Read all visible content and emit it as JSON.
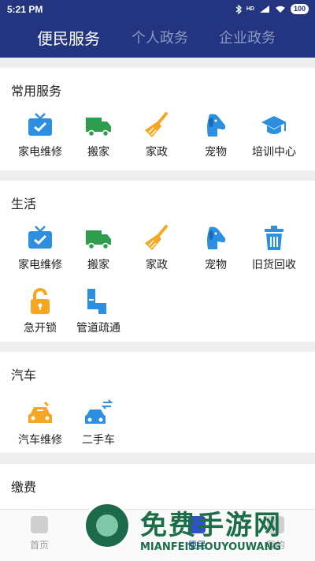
{
  "status": {
    "time": "5:21 PM",
    "network": "HD",
    "battery": "100"
  },
  "tabs": [
    {
      "label": "便民服务",
      "active": true
    },
    {
      "label": "个人政务",
      "active": false
    },
    {
      "label": "企业政务",
      "active": false
    }
  ],
  "sections": [
    {
      "title": "常用服务",
      "items": [
        {
          "label": "家电维修",
          "icon": "tv-icon"
        },
        {
          "label": "搬家",
          "icon": "truck-icon"
        },
        {
          "label": "家政",
          "icon": "broom-icon"
        },
        {
          "label": "宠物",
          "icon": "dog-icon"
        },
        {
          "label": "培训中心",
          "icon": "graduation-cap-icon"
        }
      ]
    },
    {
      "title": "生活",
      "items": [
        {
          "label": "家电维修",
          "icon": "tv-icon"
        },
        {
          "label": "搬家",
          "icon": "truck-icon"
        },
        {
          "label": "家政",
          "icon": "broom-icon"
        },
        {
          "label": "宠物",
          "icon": "dog-icon"
        },
        {
          "label": "旧货回收",
          "icon": "trash-icon"
        },
        {
          "label": "急开锁",
          "icon": "unlock-icon"
        },
        {
          "label": "管道疏通",
          "icon": "pipe-icon"
        }
      ]
    },
    {
      "title": "汽车",
      "items": [
        {
          "label": "汽车维修",
          "icon": "car-repair-icon"
        },
        {
          "label": "二手车",
          "icon": "car-exchange-icon"
        }
      ]
    },
    {
      "title": "缴费",
      "items": []
    }
  ],
  "bottom_nav": [
    {
      "label": "首页",
      "icon": "home-icon",
      "active": false
    },
    {
      "label": "",
      "icon": "service-icon",
      "active": false
    },
    {
      "label": "便民",
      "icon": "convenience-icon",
      "active": true
    },
    {
      "label": "我的",
      "icon": "profile-icon",
      "active": false
    }
  ],
  "watermark": {
    "title": "免费手游网",
    "subtitle": "MIANFEISHOUYOUWANG"
  },
  "colors": {
    "header": "#233580",
    "blue": "#2d8fe0",
    "green": "#2e9e4e",
    "orange": "#f5a623"
  }
}
